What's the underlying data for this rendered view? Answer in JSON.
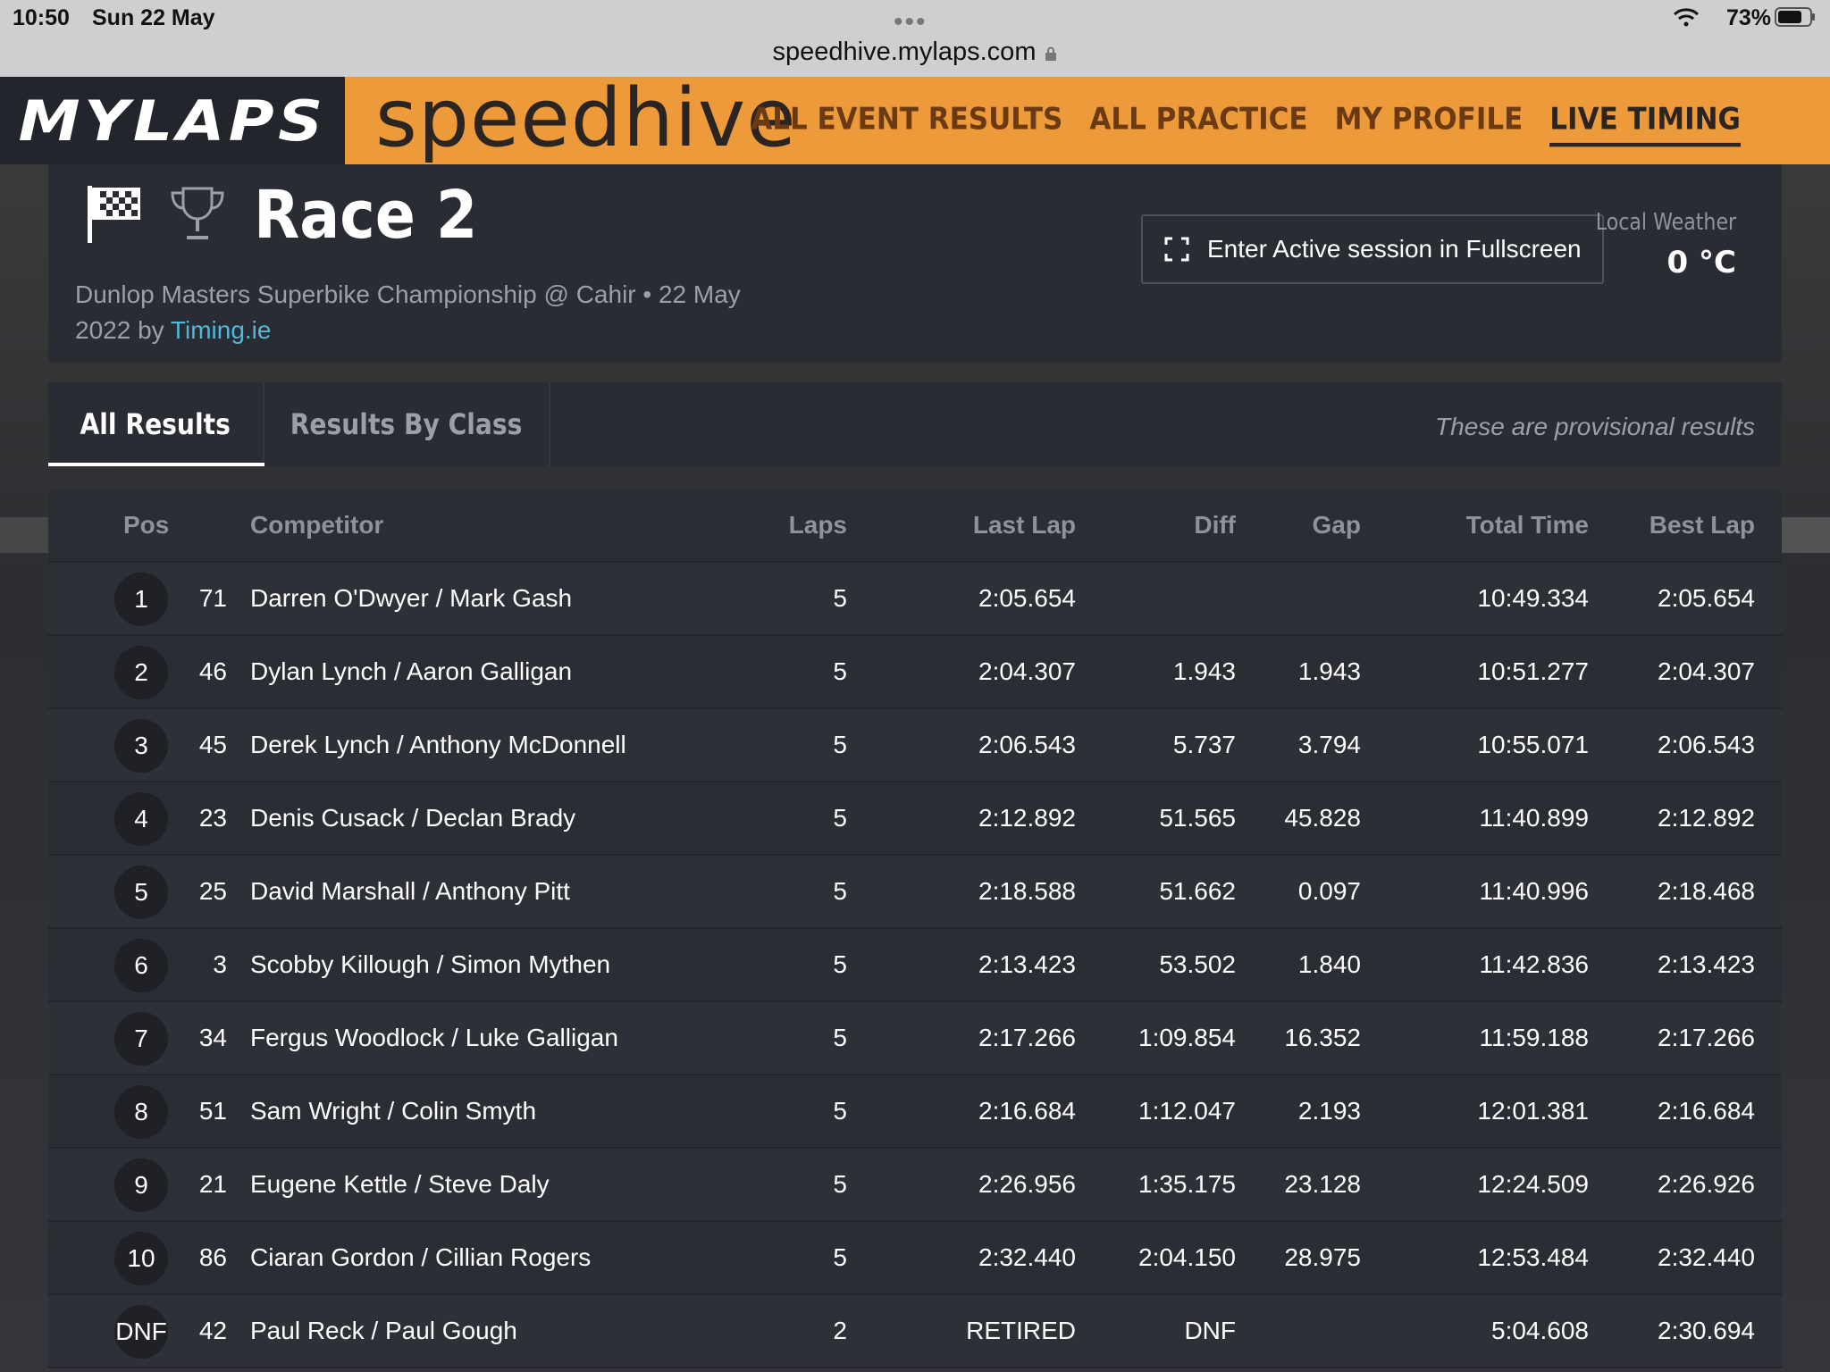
{
  "status_bar": {
    "time": "10:50",
    "date": "Sun 22 May",
    "url": "speedhive.mylaps.com",
    "battery": "73%"
  },
  "header": {
    "logo": "MYLAPS",
    "brand": "speedhive",
    "nav": [
      "ALL EVENT RESULTS",
      "ALL PRACTICE",
      "MY PROFILE",
      "LIVE TIMING"
    ],
    "accent": "#ed9b3a"
  },
  "race": {
    "title": "Race 2",
    "subtitle_line1": "Dunlop Masters Superbike Championship @ Cahir • 22 May",
    "subtitle_line2_prefix": "2022 by ",
    "organizer": "Timing.ie",
    "fullscreen_label": "Enter Active session in Fullscreen",
    "weather_label": "Local Weather",
    "weather_value": "0 °C"
  },
  "tabs": {
    "all": "All Results",
    "by_class": "Results By Class",
    "note": "These are provisional results"
  },
  "columns": {
    "pos": "Pos",
    "competitor": "Competitor",
    "laps": "Laps",
    "last_lap": "Last Lap",
    "diff": "Diff",
    "gap": "Gap",
    "total_time": "Total Time",
    "best_lap": "Best Lap"
  },
  "rows": [
    {
      "pos": "1",
      "num": "71",
      "name": "Darren O'Dwyer / Mark Gash",
      "laps": "5",
      "last": "2:05.654",
      "diff": "",
      "gap": "",
      "total": "10:49.334",
      "best": "2:05.654"
    },
    {
      "pos": "2",
      "num": "46",
      "name": "Dylan Lynch / Aaron Galligan",
      "laps": "5",
      "last": "2:04.307",
      "diff": "1.943",
      "gap": "1.943",
      "total": "10:51.277",
      "best": "2:04.307"
    },
    {
      "pos": "3",
      "num": "45",
      "name": "Derek Lynch / Anthony McDonnell",
      "laps": "5",
      "last": "2:06.543",
      "diff": "5.737",
      "gap": "3.794",
      "total": "10:55.071",
      "best": "2:06.543"
    },
    {
      "pos": "4",
      "num": "23",
      "name": "Denis Cusack / Declan Brady",
      "laps": "5",
      "last": "2:12.892",
      "diff": "51.565",
      "gap": "45.828",
      "total": "11:40.899",
      "best": "2:12.892"
    },
    {
      "pos": "5",
      "num": "25",
      "name": "David Marshall / Anthony Pitt",
      "laps": "5",
      "last": "2:18.588",
      "diff": "51.662",
      "gap": "0.097",
      "total": "11:40.996",
      "best": "2:18.468"
    },
    {
      "pos": "6",
      "num": "3",
      "name": "Scobby Killough / Simon Mythen",
      "laps": "5",
      "last": "2:13.423",
      "diff": "53.502",
      "gap": "1.840",
      "total": "11:42.836",
      "best": "2:13.423"
    },
    {
      "pos": "7",
      "num": "34",
      "name": "Fergus Woodlock / Luke Galligan",
      "laps": "5",
      "last": "2:17.266",
      "diff": "1:09.854",
      "gap": "16.352",
      "total": "11:59.188",
      "best": "2:17.266"
    },
    {
      "pos": "8",
      "num": "51",
      "name": "Sam Wright / Colin Smyth",
      "laps": "5",
      "last": "2:16.684",
      "diff": "1:12.047",
      "gap": "2.193",
      "total": "12:01.381",
      "best": "2:16.684"
    },
    {
      "pos": "9",
      "num": "21",
      "name": "Eugene Kettle / Steve Daly",
      "laps": "5",
      "last": "2:26.956",
      "diff": "1:35.175",
      "gap": "23.128",
      "total": "12:24.509",
      "best": "2:26.926"
    },
    {
      "pos": "10",
      "num": "86",
      "name": "Ciaran Gordon / Cillian Rogers",
      "laps": "5",
      "last": "2:32.440",
      "diff": "2:04.150",
      "gap": "28.975",
      "total": "12:53.484",
      "best": "2:32.440"
    },
    {
      "pos": "DNF",
      "num": "42",
      "name": "Paul Reck / Paul Gough",
      "laps": "2",
      "last": "RETIRED",
      "diff": "DNF",
      "gap": "",
      "total": "5:04.608",
      "best": "2:30.694"
    }
  ]
}
